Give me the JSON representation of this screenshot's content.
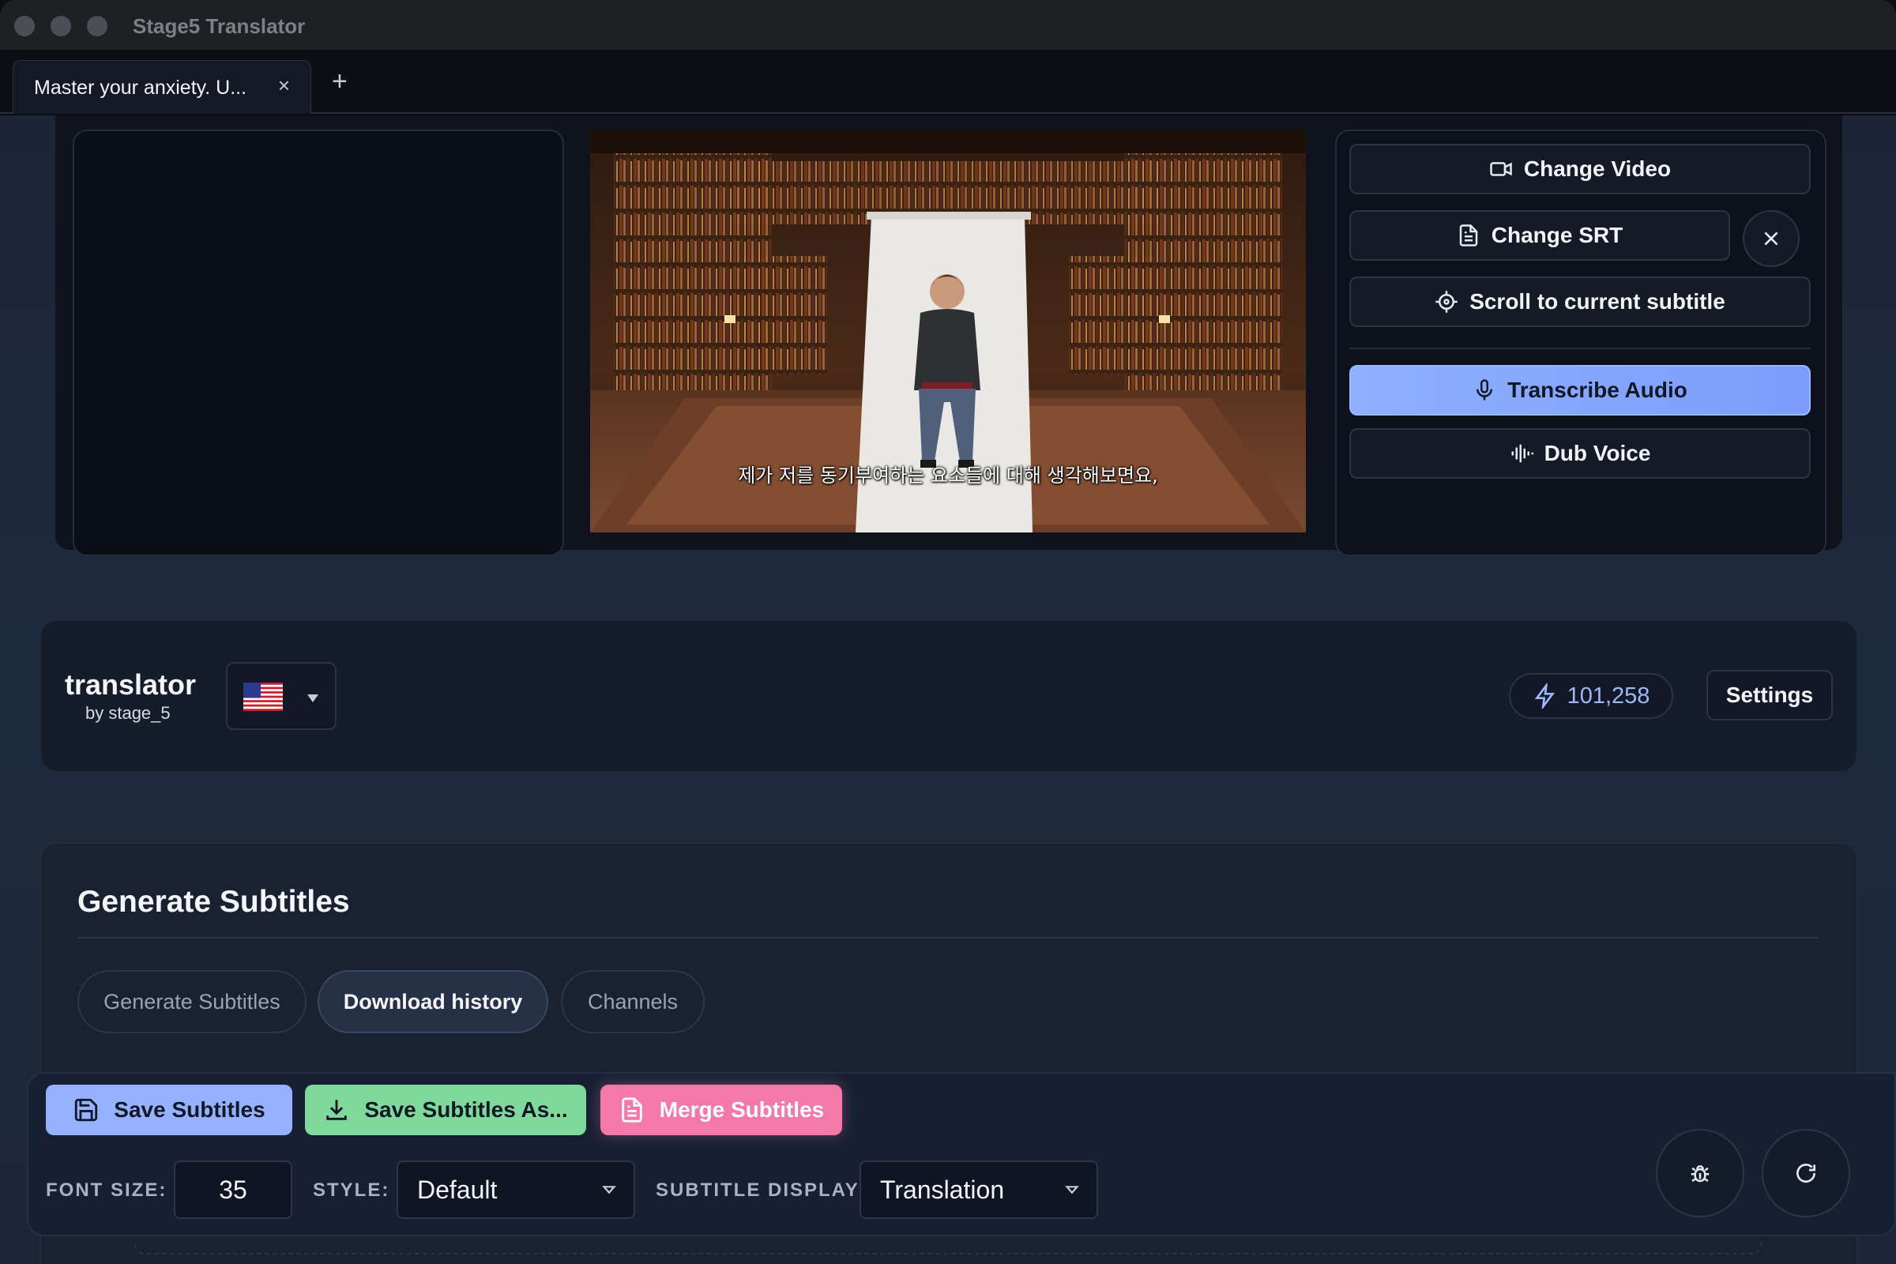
{
  "window": {
    "title": "Stage5 Translator"
  },
  "tabs": [
    {
      "label": "Master your anxiety. U...",
      "close": "×"
    }
  ],
  "new_tab_label": "+",
  "video": {
    "subtitle": "제가 저를 동기부여하는 요소들에 대해 생각해보면요,"
  },
  "video_controls": {
    "change_video": "Change Video",
    "change_srt": "Change SRT",
    "scroll_to_current": "Scroll to current subtitle",
    "transcribe_audio": "Transcribe Audio",
    "dub_voice": "Dub Voice"
  },
  "header": {
    "brand_name": "translator",
    "brand_sub": "by stage_5",
    "language_flag": "us-flag-icon",
    "credits": "101,258",
    "settings": "Settings"
  },
  "subtitles_panel": {
    "title": "Generate Subtitles",
    "tabs": [
      {
        "label": "Generate Subtitles",
        "active": false
      },
      {
        "label": "Download history",
        "active": true
      },
      {
        "label": "Channels",
        "active": false
      }
    ]
  },
  "toolbar": {
    "save_subtitles": "Save Subtitles",
    "save_subtitles_as": "Save Subtitles As...",
    "merge_subtitles": "Merge Subtitles",
    "font_size_label": "FONT SIZE:",
    "font_size_value": "35",
    "style_label": "STYLE:",
    "style_value": "Default",
    "subtitle_display_label": "SUBTITLE DISPLAY",
    "subtitle_display_value": "Translation"
  },
  "colors": {
    "accent_blue": "#8fb0ff",
    "accent_green": "#7ed99a",
    "accent_pink": "#f37aa8",
    "credits_text": "#9fb7f5"
  }
}
